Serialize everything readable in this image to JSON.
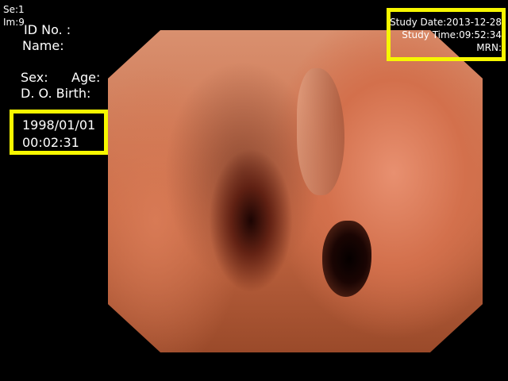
{
  "series": "Se:1",
  "image": "Im:9",
  "patient": {
    "id_label": "ID  No. :",
    "name_label": "Name:",
    "sex_label": "Sex:",
    "age_label": "Age:",
    "dob_label": "D. O. Birth:"
  },
  "clock": {
    "date": "1998/01/01",
    "time": "00:02:31"
  },
  "study": {
    "date": "Study Date:2013-12-28",
    "time": "Study Time:09:52:34",
    "mrn": "MRN:"
  },
  "colors": {
    "highlight": "#f7f700",
    "text": "#ffffff",
    "background": "#000000"
  }
}
